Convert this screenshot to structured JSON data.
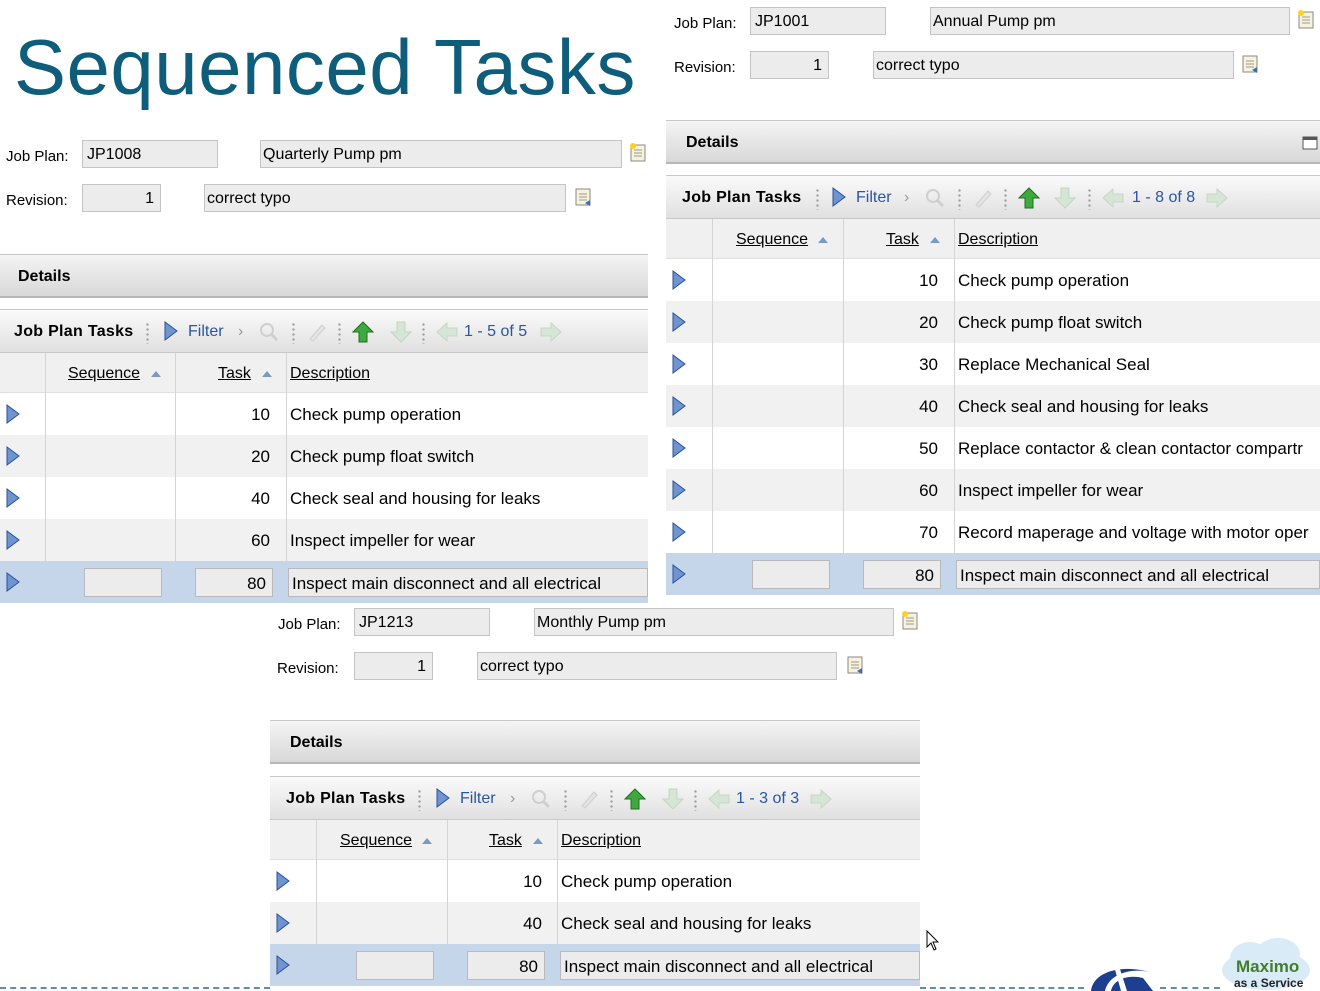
{
  "slide": {
    "title": "Sequenced Tasks"
  },
  "panels": [
    {
      "id": "jp1001",
      "job_plan_label": "Job Plan:",
      "job_plan_value": "JP1001",
      "job_plan_desc": "Annual Pump pm",
      "revision_label": "Revision:",
      "revision_value": "1",
      "revision_desc": "correct typo",
      "details_label": "Details",
      "tasks_label": "Job Plan Tasks",
      "filter_label": "Filter",
      "pager": "1 - 8 of 8",
      "columns": {
        "sequence": "Sequence",
        "task": "Task",
        "description": "Description"
      },
      "rows": [
        {
          "task": "10",
          "description": "Check pump operation"
        },
        {
          "task": "20",
          "description": "Check pump float switch"
        },
        {
          "task": "30",
          "description": "Replace Mechanical Seal"
        },
        {
          "task": "40",
          "description": "Check seal and housing for leaks"
        },
        {
          "task": "50",
          "description": "Replace contactor & clean contactor compartr"
        },
        {
          "task": "60",
          "description": "Inspect impeller for wear"
        },
        {
          "task": "70",
          "description": "Record maperage and voltage with motor oper"
        },
        {
          "task": "80",
          "description": "Inspect main disconnect and all electrical",
          "selected": true
        }
      ]
    },
    {
      "id": "jp1008",
      "job_plan_label": "Job Plan:",
      "job_plan_value": "JP1008",
      "job_plan_desc": "Quarterly Pump pm",
      "revision_label": "Revision:",
      "revision_value": "1",
      "revision_desc": "correct typo",
      "details_label": "Details",
      "tasks_label": "Job Plan Tasks",
      "filter_label": "Filter",
      "pager": "1 - 5 of 5",
      "columns": {
        "sequence": "Sequence",
        "task": "Task",
        "description": "Description"
      },
      "rows": [
        {
          "task": "10",
          "description": "Check pump operation"
        },
        {
          "task": "20",
          "description": "Check pump float switch"
        },
        {
          "task": "40",
          "description": "Check seal and housing for leaks"
        },
        {
          "task": "60",
          "description": "Inspect impeller for wear"
        },
        {
          "task": "80",
          "description": "Inspect main disconnect and all electrical",
          "selected": true
        }
      ]
    },
    {
      "id": "jp1213",
      "job_plan_label": "Job Plan:",
      "job_plan_value": "JP1213",
      "job_plan_desc": "Monthly Pump pm",
      "revision_label": "Revision:",
      "revision_value": "1",
      "revision_desc": "correct typo",
      "details_label": "Details",
      "tasks_label": "Job Plan Tasks",
      "filter_label": "Filter",
      "pager": "1 - 3 of 3",
      "columns": {
        "sequence": "Sequence",
        "task": "Task",
        "description": "Description"
      },
      "rows": [
        {
          "task": "10",
          "description": "Check pump operation"
        },
        {
          "task": "40",
          "description": "Check seal and housing for leaks"
        },
        {
          "task": "80",
          "description": "Inspect main disconnect and all electrical",
          "selected": true
        }
      ]
    }
  ],
  "branding": {
    "product": "Maximo",
    "tagline": "as a Service"
  },
  "colors": {
    "title": "#0e5e7b",
    "selected_row": "#c5d6ea",
    "link": "#2a55a0",
    "expand_arrow": "#2b4f9a"
  }
}
